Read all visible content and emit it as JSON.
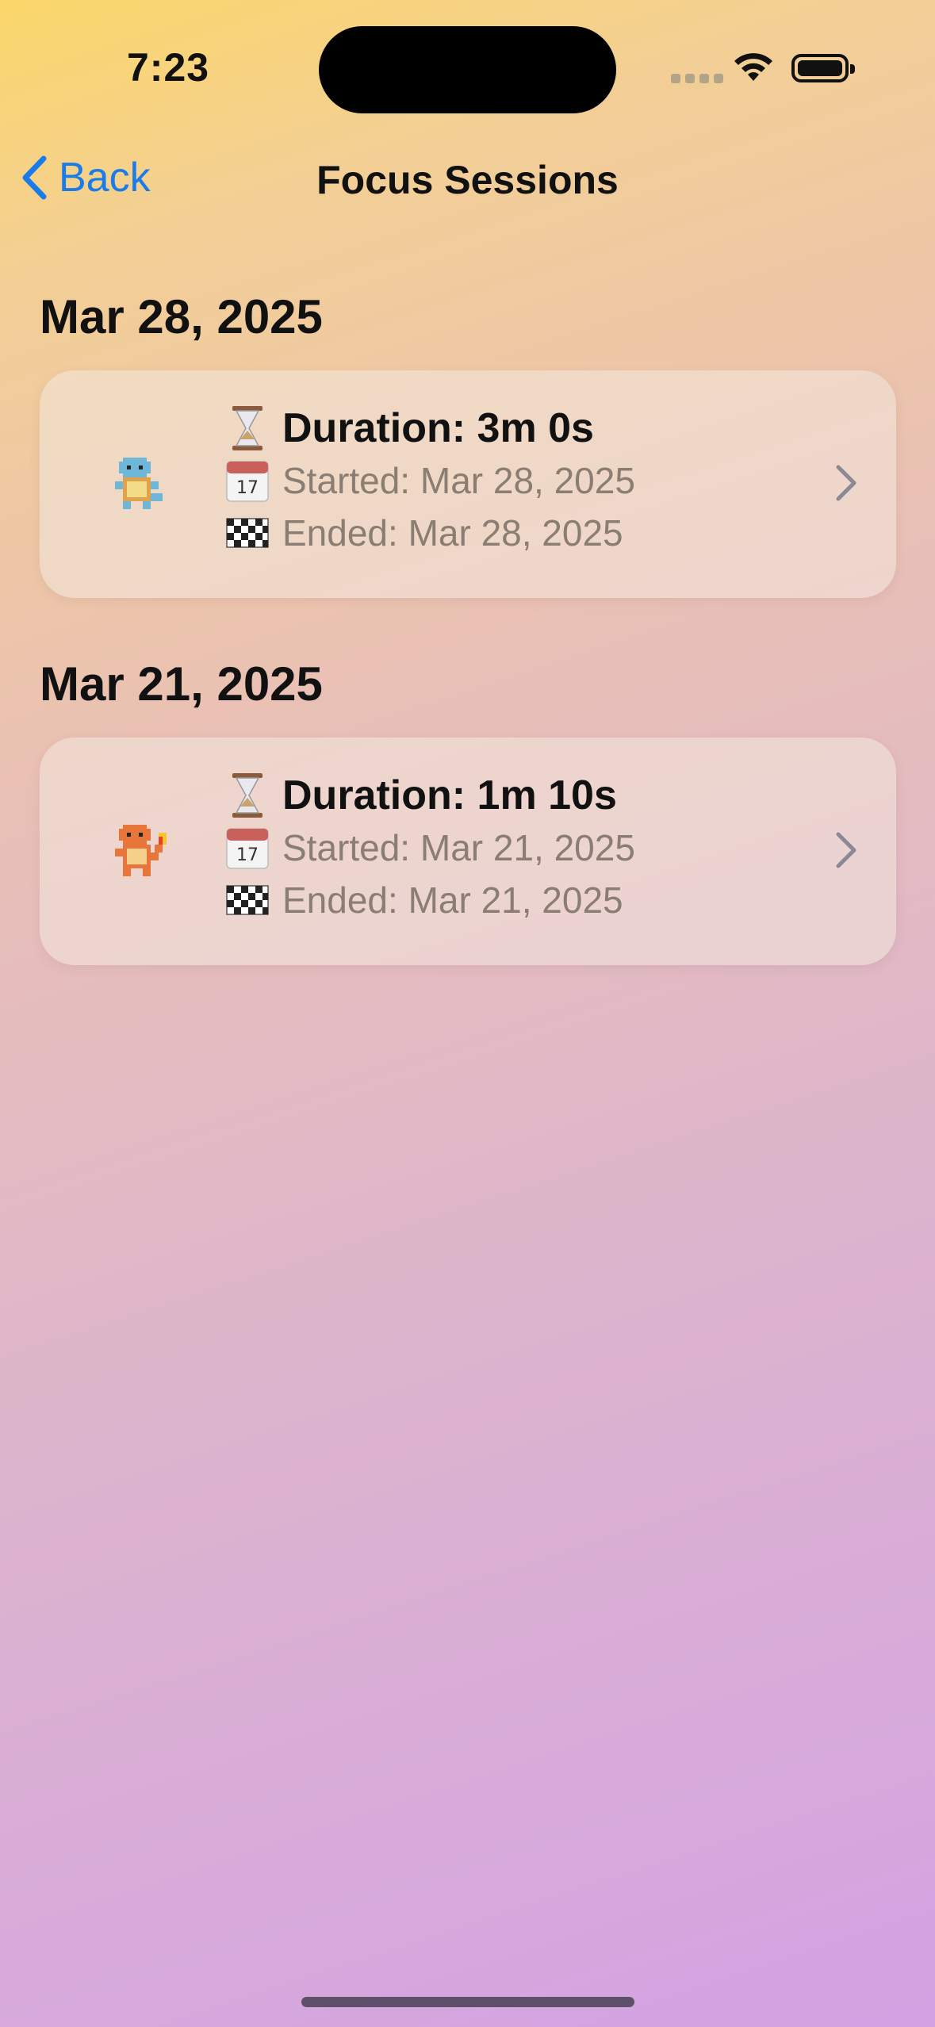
{
  "status_bar": {
    "time": "7:23"
  },
  "nav": {
    "back_label": "Back",
    "title": "Focus Sessions"
  },
  "sections": [
    {
      "date": "Mar 28, 2025",
      "session": {
        "duration": "Duration: 3m 0s",
        "started": "Started: Mar 28, 2025",
        "ended": "Ended: Mar 28, 2025",
        "avatar": "squirtle-pixel-icon"
      }
    },
    {
      "date": "Mar 21, 2025",
      "session": {
        "duration": "Duration: 1m 10s",
        "started": "Started: Mar 21, 2025",
        "ended": "Ended: Mar 21, 2025",
        "avatar": "charmander-pixel-icon"
      }
    }
  ],
  "icons": {
    "duration": "hourglass-icon",
    "started": "calendar-icon",
    "ended": "checkered-flag-icon",
    "row_action": "chevron-right-icon"
  },
  "colors": {
    "accent": "#1a7bea",
    "secondary_text": "#8a7d72",
    "gradient_top": "#fbd76a",
    "gradient_bottom": "#d3a2e3"
  }
}
